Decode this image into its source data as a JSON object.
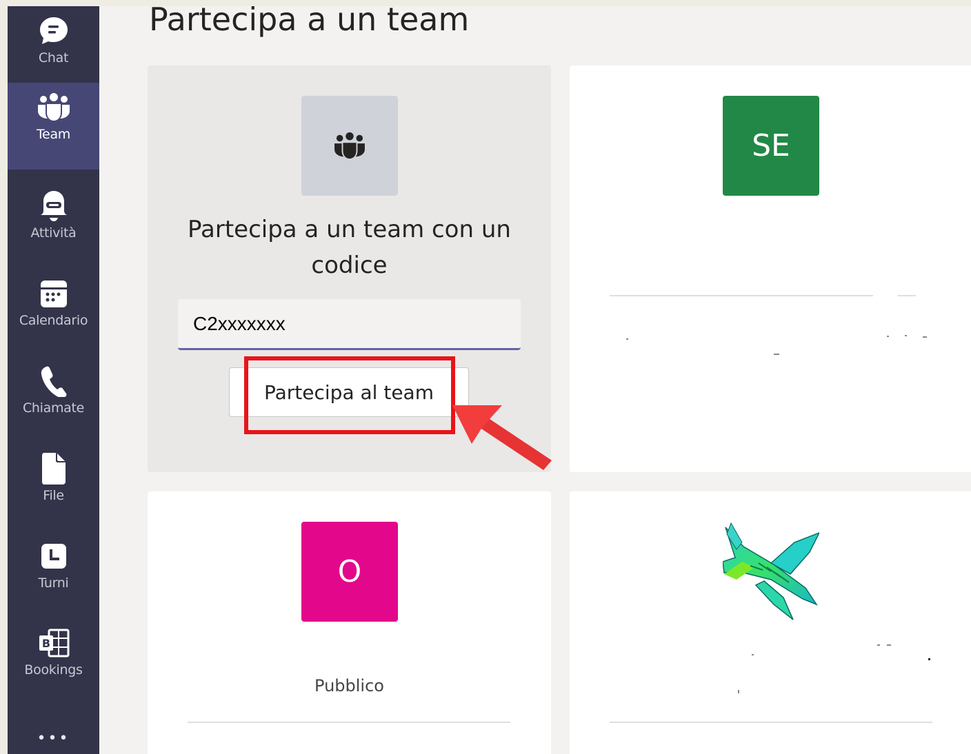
{
  "rail": {
    "items": [
      {
        "label": "Chat",
        "icon": "chat-icon"
      },
      {
        "label": "Team",
        "icon": "teams-icon",
        "active": true
      },
      {
        "label": "Attività",
        "icon": "activity-bell-icon"
      },
      {
        "label": "Calendario",
        "icon": "calendar-icon"
      },
      {
        "label": "Chiamate",
        "icon": "phone-icon"
      },
      {
        "label": "File",
        "icon": "file-icon"
      },
      {
        "label": "Turni",
        "icon": "shifts-clock-icon"
      },
      {
        "label": "Bookings",
        "icon": "bookings-icon"
      }
    ],
    "more_label": "•••"
  },
  "page": {
    "title": "Partecipa a un team"
  },
  "join_card": {
    "heading": "Partecipa a un team con un codice",
    "code_value": "C2xxxxxxx",
    "button_label": "Partecipa al team"
  },
  "teams": [
    {
      "initials": "SE",
      "color": "#228847"
    },
    {
      "initials": "O",
      "color": "#e3078b",
      "visibility": "Pubblico"
    },
    {
      "image": "airplane-image"
    }
  ],
  "colors": {
    "rail_bg": "#33344a",
    "rail_active": "#464775",
    "accent": "#6264a7",
    "highlight": "#e8141a"
  }
}
